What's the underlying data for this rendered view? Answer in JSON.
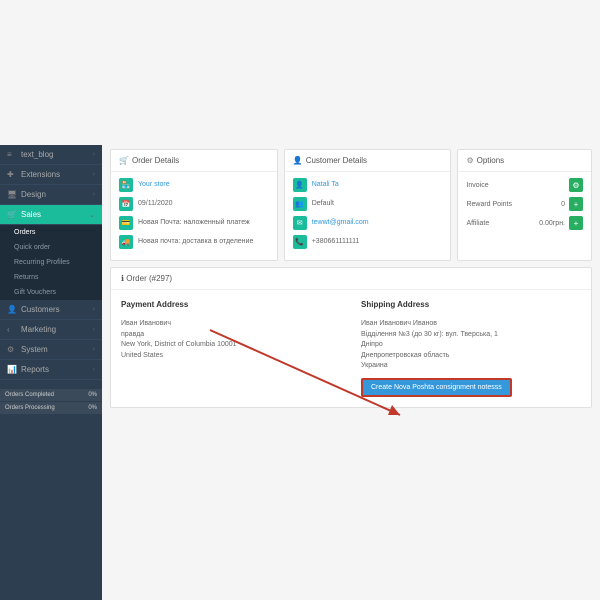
{
  "sidebar": {
    "items": [
      {
        "icon": "≡",
        "label": "text_blog"
      },
      {
        "icon": "⚙",
        "label": "Extensions"
      },
      {
        "icon": "◧",
        "label": "Design"
      },
      {
        "icon": "🛒",
        "label": "Sales",
        "active": true
      },
      {
        "icon": "👤",
        "label": "Customers"
      },
      {
        "icon": "<",
        "label": "Marketing"
      },
      {
        "icon": "⚙",
        "label": "System"
      },
      {
        "icon": "📊",
        "label": "Reports"
      }
    ],
    "subs": [
      {
        "label": "Orders",
        "sel": true
      },
      {
        "label": "Quick order"
      },
      {
        "label": "Recurring Profiles"
      },
      {
        "label": "Returns"
      },
      {
        "label": "Gift Vouchers"
      }
    ],
    "stats": [
      {
        "l": "Orders Completed",
        "v": "0%"
      },
      {
        "l": "Orders Processing",
        "v": "0%"
      }
    ]
  },
  "panels": {
    "order": {
      "title": "Order Details",
      "rows": [
        {
          "icon": "🏪",
          "text": "Your store",
          "link": true
        },
        {
          "icon": "📅",
          "text": "09/11/2020"
        },
        {
          "icon": "💳",
          "text": "Новая Почта: наложенный платеж"
        },
        {
          "icon": "🚚",
          "text": "Новая почта: доставка в отделение"
        }
      ]
    },
    "customer": {
      "title": "Customer Details",
      "rows": [
        {
          "icon": "👤",
          "text": "Natali Ta",
          "link": true
        },
        {
          "icon": "👥",
          "text": "Default"
        },
        {
          "icon": "✉",
          "text": "tewwt@gmail.com",
          "link": true
        },
        {
          "icon": "📞",
          "text": "+380661111111"
        }
      ]
    },
    "options": {
      "title": "Options",
      "rows": [
        {
          "label": "Invoice",
          "val": ""
        },
        {
          "label": "Reward Points",
          "val": "0"
        },
        {
          "label": "Affiliate",
          "val": "0.00грн."
        }
      ]
    }
  },
  "order": {
    "title": "Order (#297)",
    "payment": {
      "h": "Payment Address",
      "lines": [
        "Иван Иванович",
        "правда",
        "New York, District of Columbia 10001",
        "United States"
      ]
    },
    "shipping": {
      "h": "Shipping Address",
      "lines": [
        "Иван Иванович Иванов",
        "Відділення №3 (до 30 кг): вул. Тверська, 1",
        "Дніпро",
        "Днепропетровская область",
        "Украина"
      ],
      "btn": "Create Nova Poshta consignment notesss"
    }
  }
}
